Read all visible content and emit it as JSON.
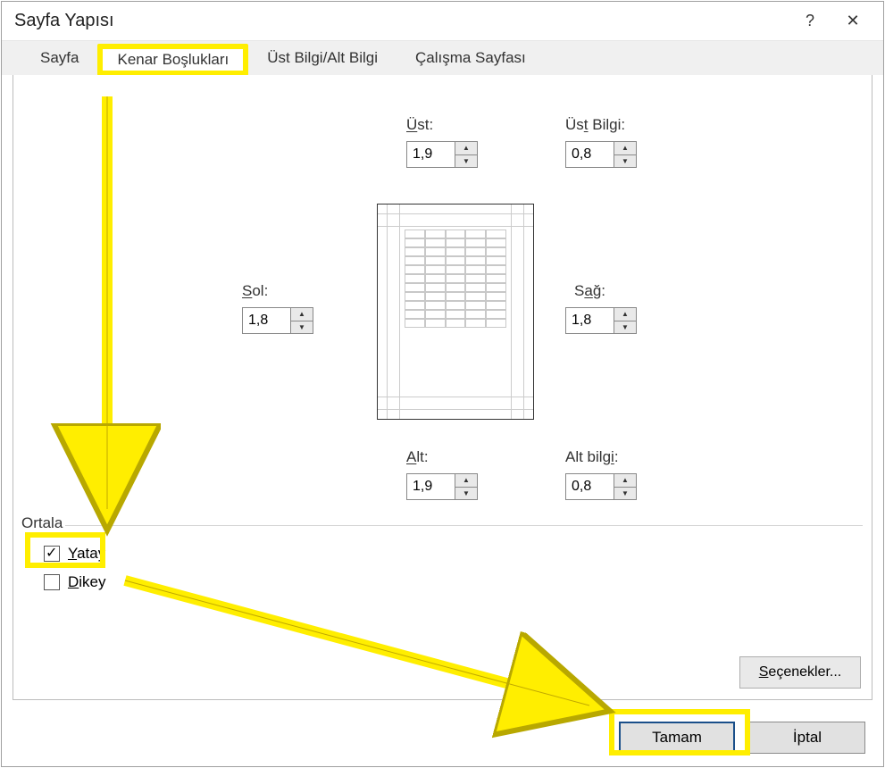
{
  "title": "Sayfa Yapısı",
  "titlebar": {
    "help": "?",
    "close": "✕"
  },
  "tabs": {
    "page": "Sayfa",
    "margins": "Kenar Boşlukları",
    "headerfooter": "Üst Bilgi/Alt Bilgi",
    "sheet": "Çalışma Sayfası"
  },
  "labels": {
    "top": "Üst:",
    "header": "Üst Bilgi:",
    "left": "Sol:",
    "right": "Sağ:",
    "bottom": "Alt:",
    "footer": "Alt bilgi:",
    "center_group": "Ortala",
    "horiz": "Yatay",
    "vert": "Dikey",
    "options": "Seçenekler..."
  },
  "values": {
    "top": "1,9",
    "header": "0,8",
    "left": "1,8",
    "right": "1,8",
    "bottom": "1,9",
    "footer": "0,8"
  },
  "checks": {
    "horiz": true,
    "vert": false
  },
  "buttons": {
    "ok": "Tamam",
    "cancel": "İptal"
  }
}
